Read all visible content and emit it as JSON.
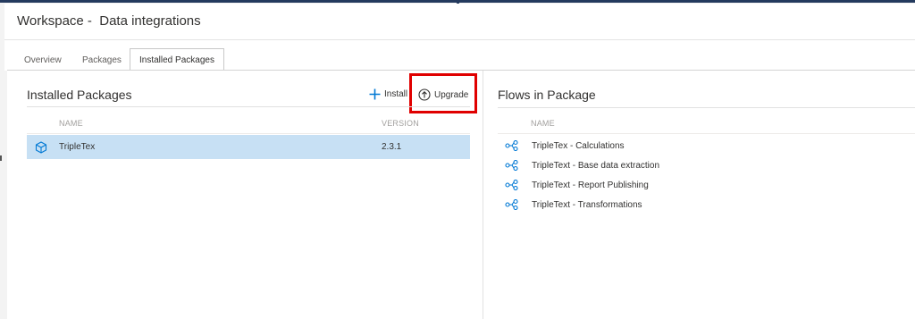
{
  "header": {
    "title": "Workspace -  Data integrations"
  },
  "tabs": [
    {
      "label": "Overview"
    },
    {
      "label": "Packages"
    },
    {
      "label": "Installed Packages"
    }
  ],
  "active_tab": "Installed Packages",
  "installed_packages": {
    "title": "Installed Packages",
    "install_label": "Install",
    "upgrade_label": "Upgrade",
    "columns": {
      "name": "NAME",
      "version": "VERSION"
    },
    "rows": [
      {
        "name": "TripleTex",
        "version": "2.3.1",
        "selected": true,
        "icon": "cube-icon"
      }
    ]
  },
  "flows": {
    "title": "Flows in Package",
    "column": "NAME",
    "items": [
      {
        "name": "TripleTex - Calculations",
        "icon": "flow-icon"
      },
      {
        "name": "TripleText - Base data extraction",
        "icon": "flow-icon"
      },
      {
        "name": "TripleText - Report Publishing",
        "icon": "flow-icon"
      },
      {
        "name": "TripleText - Transformations",
        "icon": "flow-icon"
      }
    ]
  },
  "colors": {
    "accent": "#0078d4",
    "selected_row": "#c7e0f4",
    "highlight_box": "#e00000",
    "top_bar": "#243a5e"
  }
}
